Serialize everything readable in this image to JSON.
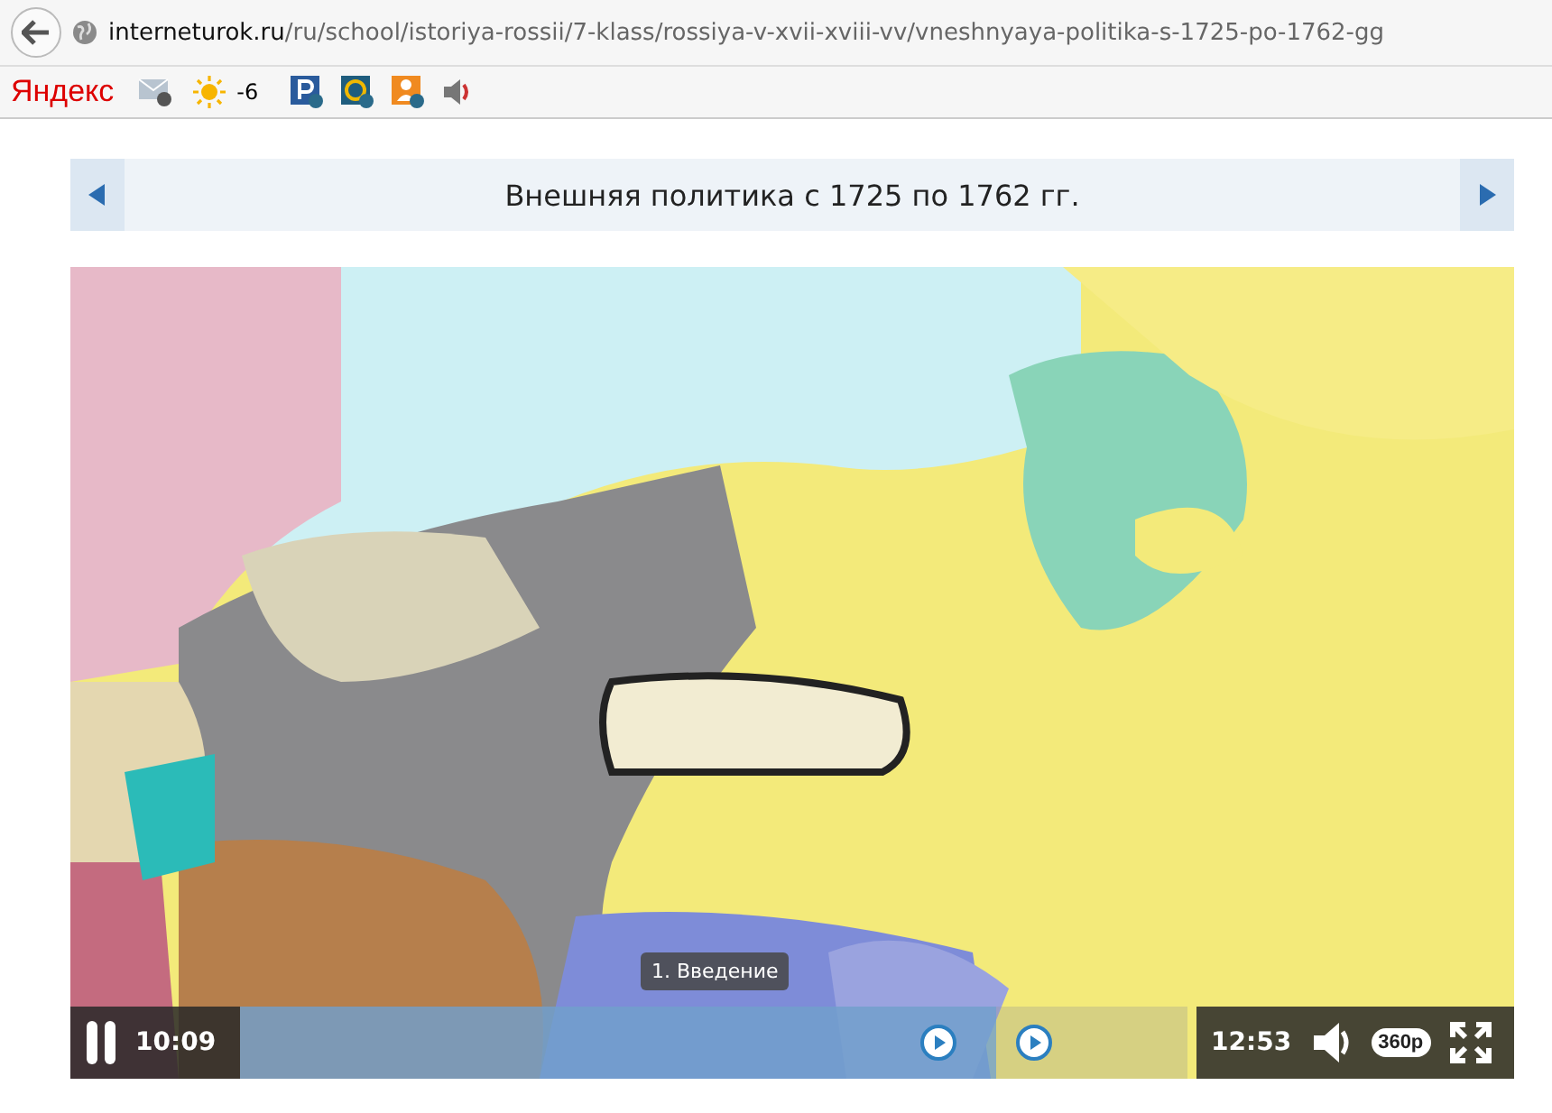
{
  "browser": {
    "url_host": "interneturok.ru",
    "url_path": "/ru/school/istoriya-rossii/7-klass/rossiya-v-xvii-xviii-vv/vneshnyaya-politika-s-1725-po-1762-gg"
  },
  "toolbar": {
    "logo": "Яндекс",
    "weather": "-6"
  },
  "lesson": {
    "title": "Внешняя политика с 1725 по 1762 гг."
  },
  "player": {
    "kind": "picture",
    "playing": true,
    "elapsed": "10:09",
    "duration": "12:53",
    "level": 0.79,
    "tooltip": "1. Введение",
    "quality": "360p"
  }
}
